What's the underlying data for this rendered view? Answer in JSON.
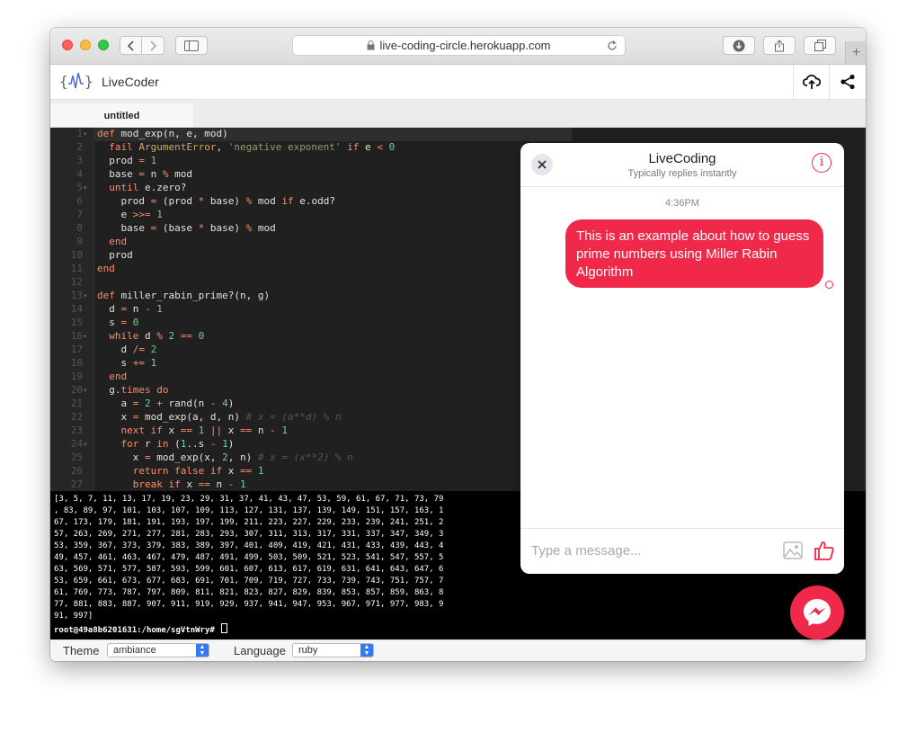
{
  "browser": {
    "url": "live-coding-circle.herokuapp.com",
    "new_tab_label": "+"
  },
  "app": {
    "logo_text": "{√}",
    "brand": "LiveCoder"
  },
  "tabs": [
    {
      "label": "untitled"
    }
  ],
  "editor": {
    "line_numbers": [
      "1",
      "2",
      "3",
      "4",
      "5",
      "6",
      "7",
      "8",
      "9",
      "10",
      "11",
      "12",
      "13",
      "14",
      "15",
      "16",
      "17",
      "18",
      "19",
      "20",
      "21",
      "22",
      "23",
      "24",
      "25",
      "26",
      "27"
    ],
    "lines": [
      "def mod_exp(n, e, mod)",
      "  fail ArgumentError, 'negative exponent' if e < 0",
      "  prod = 1",
      "  base = n % mod",
      "  until e.zero?",
      "    prod = (prod * base) % mod if e.odd?",
      "    e >>= 1",
      "    base = (base * base) % mod",
      "  end",
      "  prod",
      "end",
      "",
      "def miller_rabin_prime?(n, g)",
      "  d = n - 1",
      "  s = 0",
      "  while d % 2 == 0",
      "    d /= 2",
      "    s += 1",
      "  end",
      "  g.times do",
      "    a = 2 + rand(n - 4)",
      "    x = mod_exp(a, d, n) # x = (a**d) % n",
      "    next if x == 1 || x == n - 1",
      "    for r in (1..s - 1)",
      "      x = mod_exp(x, 2, n) # x = (x**2) % n",
      "      return false if x == 1",
      "      break if x == n - 1"
    ]
  },
  "terminal": {
    "lines": [
      "[3, 5, 7, 11, 13, 17, 19, 23, 29, 31, 37, 41, 43, 47, 53, 59, 61, 67, 71, 73, 79",
      ", 83, 89, 97, 101, 103, 107, 109, 113, 127, 131, 137, 139, 149, 151, 157, 163, 1",
      "67, 173, 179, 181, 191, 193, 197, 199, 211, 223, 227, 229, 233, 239, 241, 251, 2",
      "57, 263, 269, 271, 277, 281, 283, 293, 307, 311, 313, 317, 331, 337, 347, 349, 3",
      "53, 359, 367, 373, 379, 383, 389, 397, 401, 409, 419, 421, 431, 433, 439, 443, 4",
      "49, 457, 461, 463, 467, 479, 487, 491, 499, 503, 509, 521, 523, 541, 547, 557, 5",
      "63, 569, 571, 577, 587, 593, 599, 601, 607, 613, 617, 619, 631, 641, 643, 647, 6",
      "53, 659, 661, 673, 677, 683, 691, 701, 709, 719, 727, 733, 739, 743, 751, 757, 7",
      "61, 769, 773, 787, 797, 809, 811, 821, 823, 827, 829, 839, 853, 857, 859, 863, 8",
      "77, 881, 883, 887, 907, 911, 919, 929, 937, 941, 947, 953, 967, 971, 977, 983, 9",
      "91, 997]"
    ],
    "prompt": "root@49a8b6201631:/home/sgVtnWry# "
  },
  "settings": {
    "theme_label": "Theme",
    "theme_value": "ambiance",
    "language_label": "Language",
    "language_value": "ruby"
  },
  "chat": {
    "title": "LiveCoding",
    "subtitle": "Typically replies instantly",
    "time": "4:36PM",
    "message": "This is an example about how to guess prime numbers using Miller Rabin Algorithm",
    "input_placeholder": "Type a message...",
    "accent": "#f0284a"
  }
}
